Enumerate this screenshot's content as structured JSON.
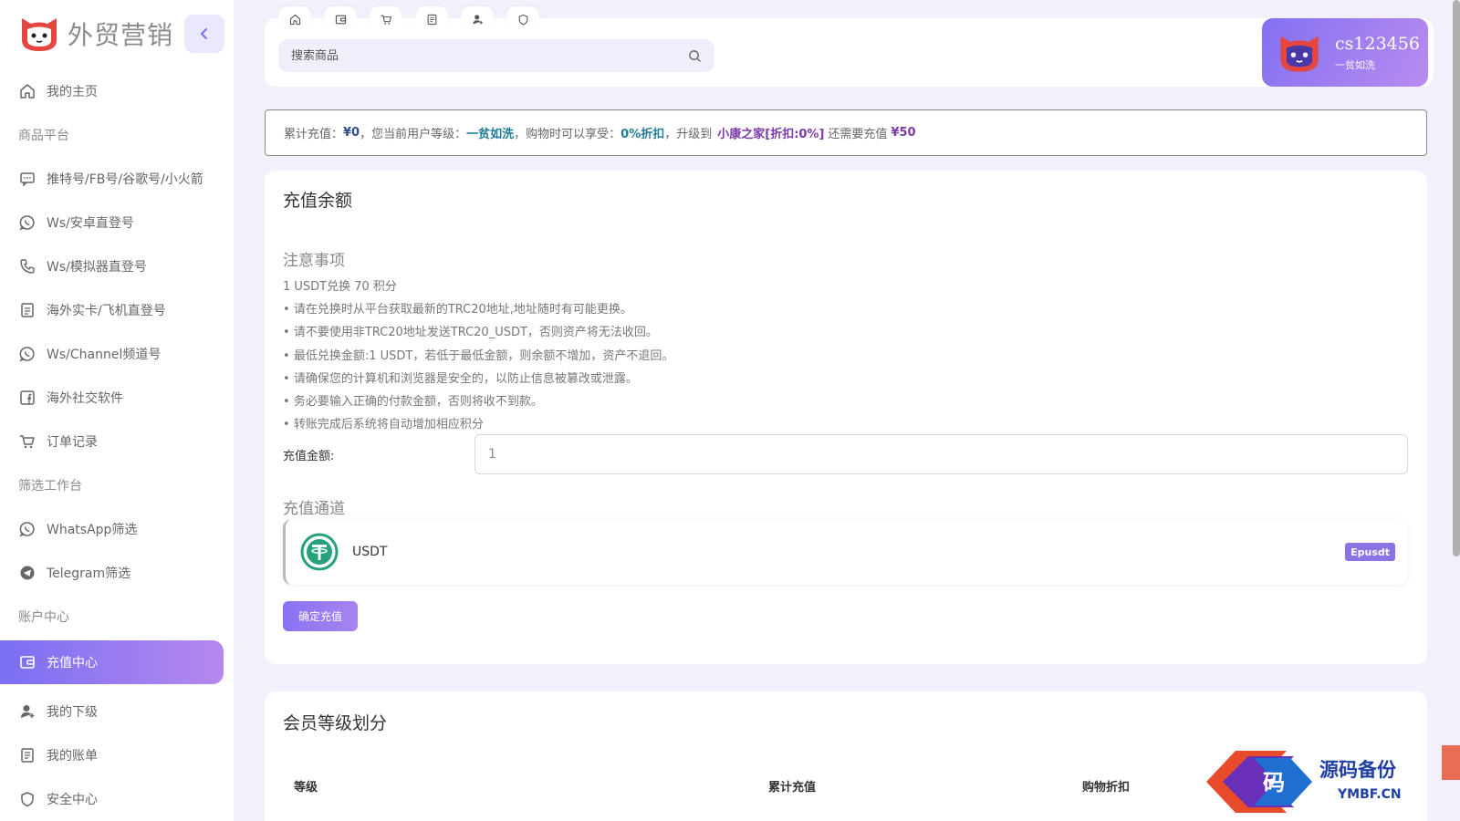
{
  "brand": {
    "name": "外贸营销",
    "logo_icon": "cat-logo-icon"
  },
  "sidebar": {
    "items": [
      {
        "type": "item",
        "label": "我的主页",
        "icon": "home-icon"
      },
      {
        "type": "section",
        "label": "商品平台"
      },
      {
        "type": "item",
        "label": "推特号/FB号/谷歌号/小火箭",
        "icon": "chat-icon"
      },
      {
        "type": "item",
        "label": "Ws/安卓直登号",
        "icon": "whatsapp-icon"
      },
      {
        "type": "item",
        "label": "Ws/模拟器直登号",
        "icon": "phone-icon"
      },
      {
        "type": "item",
        "label": "海外实卡/飞机直登号",
        "icon": "document-icon"
      },
      {
        "type": "item",
        "label": "Ws/Channel频道号",
        "icon": "whatsapp-icon"
      },
      {
        "type": "item",
        "label": "海外社交软件",
        "icon": "facebook-icon"
      },
      {
        "type": "item",
        "label": "订单记录",
        "icon": "cart-icon"
      },
      {
        "type": "section",
        "label": "筛选工作台"
      },
      {
        "type": "item",
        "label": "WhatsApp筛选",
        "icon": "whatsapp-icon"
      },
      {
        "type": "item",
        "label": "Telegram筛选",
        "icon": "telegram-icon"
      },
      {
        "type": "section",
        "label": "账户中心"
      },
      {
        "type": "item",
        "label": "充值中心",
        "icon": "wallet-icon",
        "active": true
      },
      {
        "type": "item",
        "label": "我的下级",
        "icon": "user-icon"
      },
      {
        "type": "item",
        "label": "我的账单",
        "icon": "bill-icon"
      },
      {
        "type": "item",
        "label": "安全中心",
        "icon": "shield-icon"
      }
    ]
  },
  "header": {
    "quick_tabs": [
      "home-icon",
      "wallet-icon",
      "cart-icon",
      "bill-icon",
      "user-icon",
      "shield-icon"
    ],
    "search_placeholder": "搜索商品",
    "user": {
      "name": "cs123456",
      "level": "一贫如洗"
    }
  },
  "notice": {
    "p1": "累计充值：",
    "total": "¥0",
    "p2": "，您当前用户等级：",
    "level": "一贫如洗",
    "p3": "，购物时可以享受：",
    "discount": "0%折扣",
    "p4": "，升级到",
    "next_level": "小康之家[折扣:0%]",
    "p5": "还需要充值",
    "need": "¥50"
  },
  "recharge": {
    "title": "充值余额",
    "notes_title": "注意事项",
    "rate": "1 USDT兑换 70 积分",
    "notes": [
      "请在兑换时从平台获取最新的TRC20地址,地址随时有可能更换。",
      "请不要使用非TRC20地址发送TRC20_USDT，否则资产将无法收回。",
      "最低兑换金额:1 USDT，若低于最低金额，则余额不增加，资产不退回。",
      "请确保您的计算机和浏览器是安全的，以防止信息被篡改或泄露。",
      "务必要输入正确的付款金额，否则将收不到款。",
      "转账完成后系统将自动增加相应积分"
    ],
    "amount_label": "充值金额:",
    "amount_value": "1",
    "channel_title": "充值通道",
    "channel": {
      "name": "USDT",
      "badge": "Epusdt",
      "icon": "tether-icon",
      "color": "#26a17b"
    },
    "confirm_label": "确定充值"
  },
  "levels": {
    "title": "会员等级划分",
    "headers": [
      "等级",
      "累计充值",
      "购物折扣"
    ]
  },
  "watermark": {
    "main": "源码备份",
    "sub": "YMBF.CN",
    "badge": "码"
  },
  "colors": {
    "accent": "#8470f2",
    "accent_light": "#b88cef",
    "background": "#f1f0fb"
  }
}
